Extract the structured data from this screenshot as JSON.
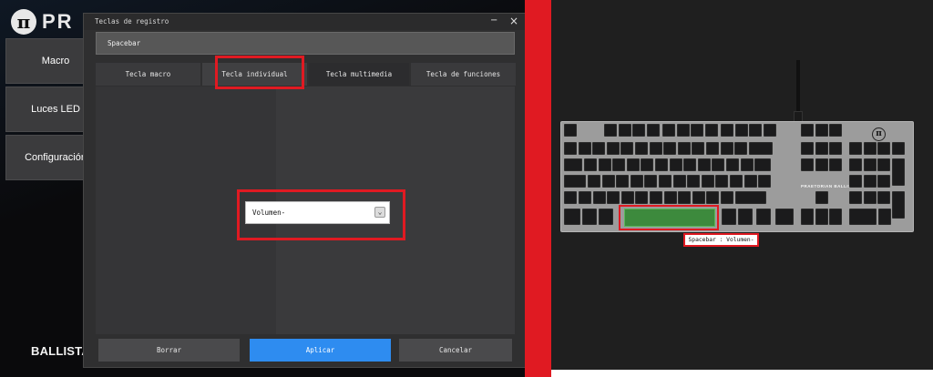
{
  "app": {
    "brand_text": "PR",
    "logo_glyph": "π",
    "sidebar": {
      "items": [
        {
          "label": "Macro"
        },
        {
          "label": "Luces LED"
        },
        {
          "label": "Configuración"
        }
      ]
    },
    "bottom_brand": "BALLISTA",
    "dialog": {
      "title": "Teclas de registro",
      "minimize_glyph": "−",
      "close_glyph": "×",
      "key_value": "Spacebar",
      "tabs": [
        {
          "label": "Tecla macro"
        },
        {
          "label": "Tecla individual"
        },
        {
          "label": "Tecla multimedia"
        },
        {
          "label": "Tecla de funciones"
        }
      ],
      "selected_tab": "Tecla individual",
      "select_value": "Volumen-",
      "select_arrow_glyph": "⌄",
      "buttons": {
        "borrar": "Borrar",
        "aplicar": "Aplicar",
        "cancelar": "Cancelar"
      }
    }
  },
  "preview": {
    "logo_glyph": "π",
    "brand_text": "PRAETORIAN BALLISTA",
    "assignment_label": "Spacebar : Volumen-"
  },
  "colors": {
    "highlight_red": "#e01a22",
    "apply_blue": "#2e8cf0",
    "spacebar_green": "#3d8a3d"
  },
  "icons": [
    "logo-mark-icon",
    "minimize-icon",
    "close-icon",
    "dropdown-arrow-icon",
    "keyboard-logo-icon"
  ]
}
